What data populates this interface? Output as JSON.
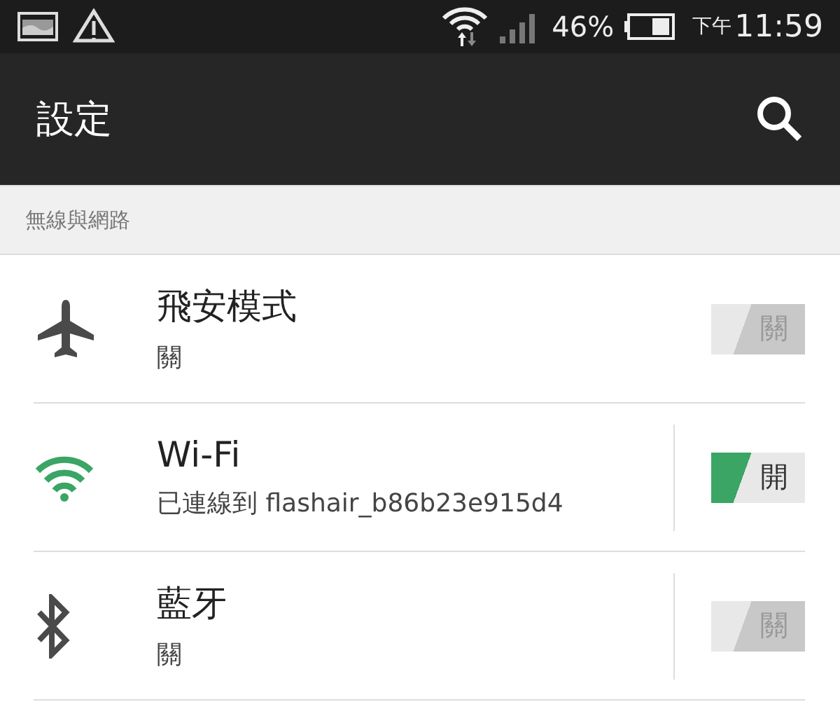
{
  "status_bar": {
    "battery": "46%",
    "period": "下午",
    "time": "11:59"
  },
  "app_bar": {
    "title": "設定"
  },
  "section": {
    "title": "無線與網路"
  },
  "rows": [
    {
      "kind": "airplane",
      "title": "飛安模式",
      "subtitle": "關",
      "on": false,
      "toggle_label": "關",
      "divider": false
    },
    {
      "kind": "wifi",
      "title": "Wi-Fi",
      "subtitle": "已連線到 flashair_b86b23e915d4",
      "on": true,
      "toggle_label": "開",
      "divider": true
    },
    {
      "kind": "bluetooth",
      "title": "藍牙",
      "subtitle": "關",
      "on": false,
      "toggle_label": "關",
      "divider": true
    }
  ]
}
